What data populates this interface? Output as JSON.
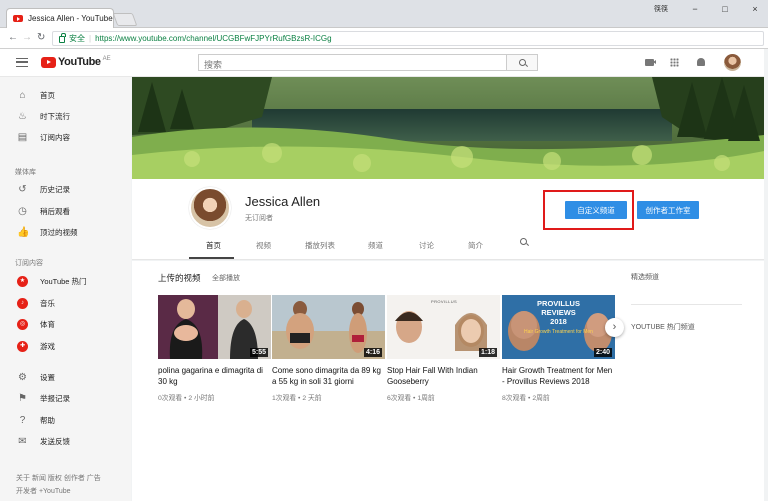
{
  "browser": {
    "tab_title": "Jessica Allen - YouTube",
    "tab_close": "×",
    "window_user": "筷筷",
    "window_controls": [
      "−",
      "□",
      "×"
    ],
    "secure_label": "安全",
    "url": "https://www.youtube.com/channel/UCGBFwFJPYrRufGBzsR-ICGg"
  },
  "masthead": {
    "logo_text": "YouTube",
    "logo_region": "AE",
    "search_placeholder": "搜索"
  },
  "sidebar": {
    "main": [
      {
        "label": "首页",
        "icon": "home-icon"
      },
      {
        "label": "时下流行",
        "icon": "trending-icon"
      },
      {
        "label": "订阅内容",
        "icon": "subscriptions-icon"
      }
    ],
    "library_heading": "媒体库",
    "library": [
      {
        "label": "历史记录",
        "icon": "history-icon"
      },
      {
        "label": "稍后观看",
        "icon": "watch-later-icon"
      },
      {
        "label": "顶过的视频",
        "icon": "liked-icon"
      }
    ],
    "subs_heading": "订阅内容",
    "subs": [
      {
        "label": "YouTube 热门",
        "icon": "youtube-popular-icon"
      },
      {
        "label": "音乐",
        "icon": "music-icon"
      },
      {
        "label": "体育",
        "icon": "sports-icon"
      },
      {
        "label": "游戏",
        "icon": "gaming-icon"
      }
    ],
    "settings": [
      {
        "label": "设置",
        "icon": "gear-icon"
      },
      {
        "label": "举报记录",
        "icon": "flag-icon"
      },
      {
        "label": "帮助",
        "icon": "help-icon"
      },
      {
        "label": "发送反馈",
        "icon": "feedback-icon"
      }
    ],
    "footer_line1": "关于  新闻  版权  创作者  广告",
    "footer_line2": "开发者  +YouTube"
  },
  "channel": {
    "name": "Jessica Allen",
    "subscribers": "无订阅者",
    "customize_button": "自定义频道",
    "studio_button": "创作者工作室",
    "tabs": [
      "首页",
      "视频",
      "播放列表",
      "频道",
      "讨论",
      "简介"
    ]
  },
  "uploads": {
    "title": "上传的视频",
    "play_all": "全部播放",
    "videos": [
      {
        "title": "polina gagarina e dimagrita di 30 kg",
        "duration": "5:55",
        "meta": "0次观看 • 2 小时前"
      },
      {
        "title": "Come sono dimagrita da 89 kg a 55 kg in soli 31 giorni",
        "duration": "4:16",
        "meta": "1次观看 • 2 天前"
      },
      {
        "title": "Stop Hair Fall With Indian Gooseberry",
        "duration": "1:18",
        "meta": "6次观看 • 1周前"
      },
      {
        "title": "Hair Growth Treatment for Men - Provillus Reviews 2018",
        "duration": "2:40",
        "meta": "8次观看 • 2周前"
      }
    ],
    "thumb4_overlay": [
      "PROVILLUS",
      "REVIEWS",
      "2018",
      "Hair Growth Treatment for Men"
    ],
    "thumb3_logo": "PROVILLUS"
  },
  "right_rail": {
    "featured": "精选频道",
    "popular": "YOUTUBE 热门频道"
  }
}
